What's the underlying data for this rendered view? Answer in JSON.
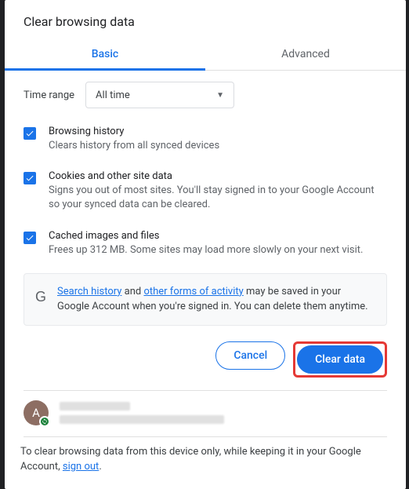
{
  "title": "Clear browsing data",
  "tabs": {
    "basic": "Basic",
    "advanced": "Advanced"
  },
  "timerange": {
    "label": "Time range",
    "value": "All time"
  },
  "items": [
    {
      "title": "Browsing history",
      "desc": "Clears history from all synced devices"
    },
    {
      "title": "Cookies and other site data",
      "desc": "Signs you out of most sites. You'll stay signed in to your Google Account so your synced data can be cleared."
    },
    {
      "title": "Cached images and files",
      "desc": "Frees up 312 MB. Some sites may load more slowly on your next visit."
    }
  ],
  "info": {
    "link1": "Search history",
    "mid1": " and ",
    "link2": "other forms of activity",
    "tail": " may be saved in your Google Account when you're signed in. You can delete them anytime."
  },
  "buttons": {
    "cancel": "Cancel",
    "clear": "Clear data"
  },
  "account": {
    "initial": "A"
  },
  "footer": {
    "text": "To clear browsing data from this device only, while keeping it in your Google Account, ",
    "link": "sign out",
    "tail": "."
  }
}
